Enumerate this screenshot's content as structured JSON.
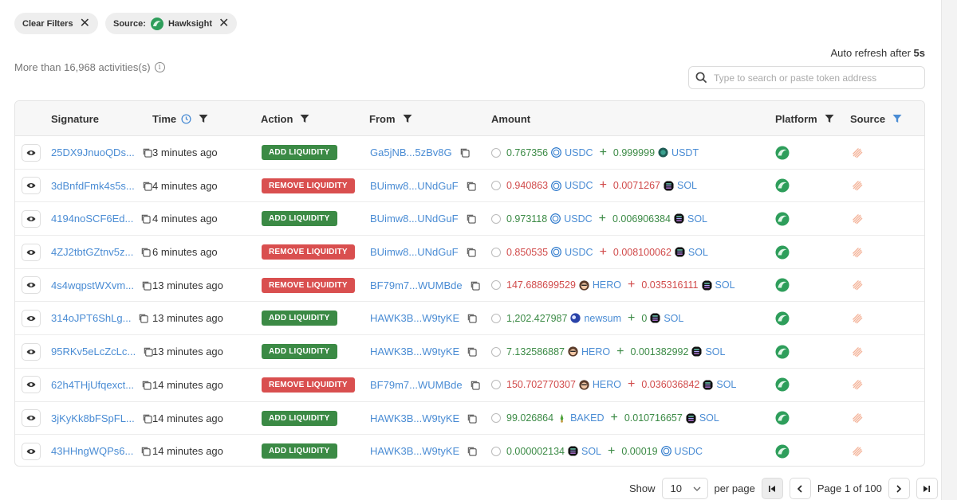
{
  "filters": {
    "clear_label": "Clear Filters",
    "source_prefix": "Source:",
    "source_value": "Hawksight"
  },
  "auto_refresh": {
    "label": "Auto refresh after",
    "value": "5s"
  },
  "activities_count": "More than 16,968 activities(s)",
  "search": {
    "placeholder": "Type to search or paste token address",
    "value": ""
  },
  "columns": {
    "signature": "Signature",
    "time": "Time",
    "action": "Action",
    "from": "From",
    "amount": "Amount",
    "platform": "Platform",
    "source": "Source"
  },
  "colors": {
    "add": "#3b8a45",
    "remove": "#d94f4f",
    "link": "#4a8cd4",
    "platform_green": "#2e9e5b",
    "source_peach": "#f3b39a"
  },
  "rows": [
    {
      "signature": "25DX9JnuoQDs...",
      "time": "3 minutes ago",
      "action": "ADD LIQUIDITY",
      "action_type": "add",
      "from": "Ga5jNB...5zBv8G",
      "amount1": "0.767356",
      "token1": "USDC",
      "token1_icon": "usdc-icon",
      "amount2": "0.999999",
      "token2": "USDT",
      "token2_icon": "usdt-icon"
    },
    {
      "signature": "3dBnfdFmk4s5s...",
      "time": "4 minutes ago",
      "action": "REMOVE LIQUIDITY",
      "action_type": "remove",
      "from": "BUimw8...UNdGuF",
      "amount1": "0.940863",
      "token1": "USDC",
      "token1_icon": "usdc-icon",
      "amount2": "0.0071267",
      "token2": "SOL",
      "token2_icon": "sol-icon"
    },
    {
      "signature": "4194noSCF6Ed...",
      "time": "4 minutes ago",
      "action": "ADD LIQUIDITY",
      "action_type": "add",
      "from": "BUimw8...UNdGuF",
      "amount1": "0.973118",
      "token1": "USDC",
      "token1_icon": "usdc-icon",
      "amount2": "0.006906384",
      "token2": "SOL",
      "token2_icon": "sol-icon"
    },
    {
      "signature": "4ZJ2tbtGZtnv5z...",
      "time": "6 minutes ago",
      "action": "REMOVE LIQUIDITY",
      "action_type": "remove",
      "from": "BUimw8...UNdGuF",
      "amount1": "0.850535",
      "token1": "USDC",
      "token1_icon": "usdc-icon",
      "amount2": "0.008100062",
      "token2": "SOL",
      "token2_icon": "sol-icon"
    },
    {
      "signature": "4s4wqpstWXvm...",
      "time": "13 minutes ago",
      "action": "REMOVE LIQUIDITY",
      "action_type": "remove",
      "from": "BF79m7...WUMBde",
      "amount1": "147.688699529",
      "token1": "HERO",
      "token1_icon": "hero-icon",
      "amount2": "0.035316111",
      "token2": "SOL",
      "token2_icon": "sol-icon"
    },
    {
      "signature": "314oJPT6ShLg...",
      "time": "13 minutes ago",
      "action": "ADD LIQUIDITY",
      "action_type": "add",
      "from": "HAWK3B...W9tyKE",
      "amount1": "1,202.427987",
      "token1": "newsum",
      "token1_icon": "newsum-icon",
      "amount2": "0",
      "token2": "SOL",
      "token2_icon": "sol-icon"
    },
    {
      "signature": "95RKv5eLcZcLc...",
      "time": "13 minutes ago",
      "action": "ADD LIQUIDITY",
      "action_type": "add",
      "from": "HAWK3B...W9tyKE",
      "amount1": "7.132586887",
      "token1": "HERO",
      "token1_icon": "hero-icon",
      "amount2": "0.001382992",
      "token2": "SOL",
      "token2_icon": "sol-icon"
    },
    {
      "signature": "62h4THjUfqexct...",
      "time": "14 minutes ago",
      "action": "REMOVE LIQUIDITY",
      "action_type": "remove",
      "from": "BF79m7...WUMBde",
      "amount1": "150.702770307",
      "token1": "HERO",
      "token1_icon": "hero-icon",
      "amount2": "0.036036842",
      "token2": "SOL",
      "token2_icon": "sol-icon"
    },
    {
      "signature": "3jKyKk8bFSpFL...",
      "time": "14 minutes ago",
      "action": "ADD LIQUIDITY",
      "action_type": "add",
      "from": "HAWK3B...W9tyKE",
      "amount1": "99.026864",
      "token1": "BAKED",
      "token1_icon": "baked-icon",
      "amount2": "0.010716657",
      "token2": "SOL",
      "token2_icon": "sol-icon"
    },
    {
      "signature": "43HHngWQPs6...",
      "time": "14 minutes ago",
      "action": "ADD LIQUIDITY",
      "action_type": "add",
      "from": "HAWK3B...W9tyKE",
      "amount1": "0.000002134",
      "token1": "SOL",
      "token1_icon": "sol-icon",
      "amount2": "0.00019",
      "token2": "USDC",
      "token2_icon": "usdc-icon"
    }
  ],
  "pagination": {
    "show_label": "Show",
    "page_size": "10",
    "per_page_label": "per page",
    "page_info": "Page 1 of 100"
  }
}
